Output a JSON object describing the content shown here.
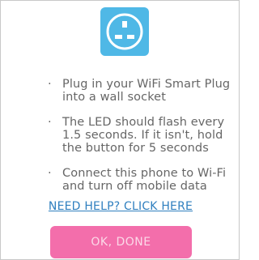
{
  "icons": {
    "plug_tile": "uk-wall-socket-icon"
  },
  "instructions": [
    {
      "bullet": "·",
      "text": "Plug in your WiFi Smart Plug into a wall socket"
    },
    {
      "bullet": "·",
      "text": "The LED should flash every 1.5 seconds. If it isn't, hold the button for 5 seconds"
    },
    {
      "bullet": "·",
      "text": "Connect this phone to Wi-Fi and turn off mobile data"
    }
  ],
  "help_link": "NEED HELP? CLICK HERE",
  "ok_button": "OK, DONE",
  "colors": {
    "icon_tile": "#4fb8e6",
    "button": "#f36eab",
    "button_text": "#fbd9e8",
    "link": "#2f7fbf",
    "body_text": "#666666"
  }
}
